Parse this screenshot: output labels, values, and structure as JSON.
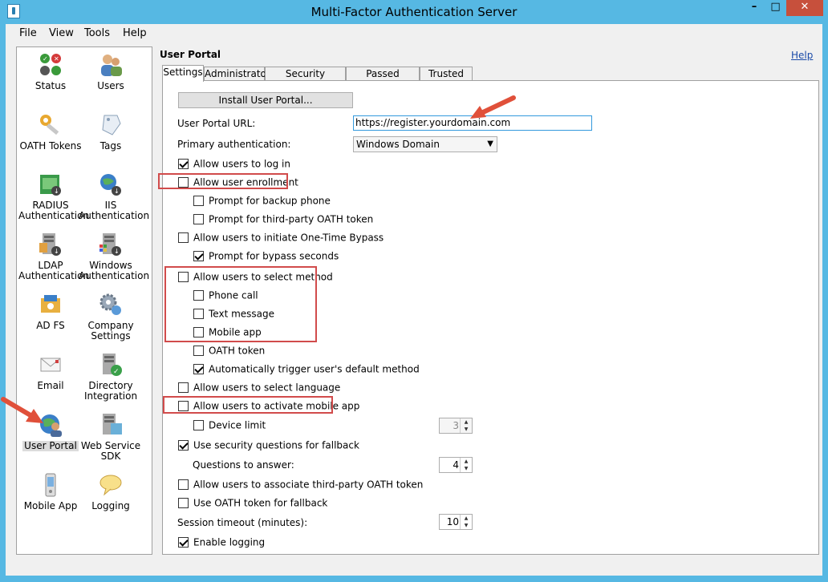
{
  "window": {
    "title": "Multi-Factor Authentication Server",
    "minimize": "–",
    "maximize": "□",
    "close": "✕"
  },
  "menu": [
    "File",
    "View",
    "Tools",
    "Help"
  ],
  "nav": {
    "items": [
      {
        "label": "Status",
        "icon": "status-icon"
      },
      {
        "label": "Users",
        "icon": "users-icon"
      },
      {
        "label": "OATH Tokens",
        "icon": "oath-tokens-icon"
      },
      {
        "label": "Tags",
        "icon": "tags-icon"
      },
      {
        "label": "RADIUS\nAuthentication",
        "label1": "RADIUS",
        "label2": "Authentication",
        "icon": "radius-icon"
      },
      {
        "label1": "IIS",
        "label2": "Authentication",
        "icon": "iis-icon"
      },
      {
        "label1": "LDAP",
        "label2": "Authentication",
        "icon": "ldap-icon"
      },
      {
        "label1": "Windows",
        "label2": "Authentication",
        "icon": "windows-auth-icon"
      },
      {
        "label": "AD FS",
        "icon": "adfs-icon"
      },
      {
        "label1": "Company",
        "label2": "Settings",
        "icon": "company-settings-icon"
      },
      {
        "label": "Email",
        "icon": "email-icon"
      },
      {
        "label1": "Directory",
        "label2": "Integration",
        "icon": "directory-integration-icon"
      },
      {
        "label": "User Portal",
        "icon": "user-portal-icon",
        "selected": true
      },
      {
        "label1": "Web Service",
        "label2": "SDK",
        "icon": "web-service-sdk-icon"
      },
      {
        "label": "Mobile App",
        "icon": "mobile-app-icon"
      },
      {
        "label": "Logging",
        "icon": "logging-icon"
      }
    ]
  },
  "pane": {
    "title": "User Portal",
    "help": "Help",
    "tabs": [
      "Settings",
      "Administrators",
      "Security Questions",
      "Passed Sessions",
      "Trusted IPs"
    ],
    "active_tab": "Settings"
  },
  "settings": {
    "install_button": "Install User Portal...",
    "url_label": "User Portal URL:",
    "url_value": "https://register.yourdomain.com",
    "primary_auth_label": "Primary authentication:",
    "primary_auth_value": "Windows Domain",
    "checkboxes": {
      "allow_login": {
        "label": "Allow users to log in",
        "checked": true
      },
      "allow_enrollment": {
        "label": "Allow user enrollment",
        "checked": false
      },
      "prompt_backup_phone": {
        "label": "Prompt for backup phone",
        "checked": false
      },
      "prompt_third_party_oath": {
        "label": "Prompt for third-party OATH token",
        "checked": false
      },
      "allow_bypass": {
        "label": "Allow users to initiate One-Time Bypass",
        "checked": false
      },
      "prompt_bypass_seconds": {
        "label": "Prompt for bypass seconds",
        "checked": true
      },
      "allow_select_method": {
        "label": "Allow users to select method",
        "checked": false
      },
      "phone_call": {
        "label": "Phone call",
        "checked": false
      },
      "text_message": {
        "label": "Text message",
        "checked": false
      },
      "mobile_app": {
        "label": "Mobile app",
        "checked": false
      },
      "oath_token": {
        "label": "OATH token",
        "checked": false
      },
      "auto_trigger": {
        "label": "Automatically trigger user's default method",
        "checked": true
      },
      "select_language": {
        "label": "Allow users to select language",
        "checked": false
      },
      "activate_mobile_app": {
        "label": "Allow users to activate mobile app",
        "checked": false
      },
      "device_limit": {
        "label": "Device limit",
        "checked": false
      },
      "security_questions_fallback": {
        "label": "Use security questions for fallback",
        "checked": true
      },
      "associate_third_party_oath": {
        "label": "Allow users to associate third-party OATH token",
        "checked": false
      },
      "oath_fallback": {
        "label": "Use OATH token for fallback",
        "checked": false
      },
      "enable_logging": {
        "label": "Enable logging",
        "checked": true
      }
    },
    "device_limit_value": "3",
    "questions_label": "Questions to answer:",
    "questions_value": "4",
    "session_timeout_label": "Session timeout (minutes):",
    "session_timeout_value": "10"
  },
  "colors": {
    "titlebar": "#56b8e3",
    "close": "#c7503c",
    "annotation": "#d14b4b",
    "link": "#1a4aa8"
  }
}
